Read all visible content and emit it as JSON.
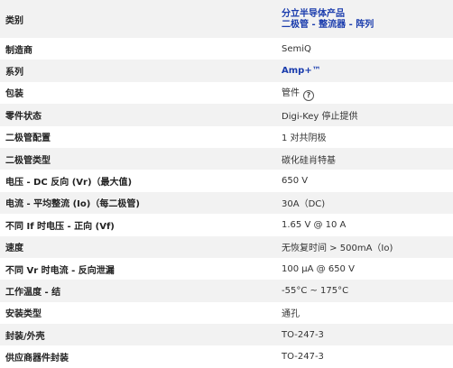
{
  "rows": [
    {
      "label": "类别",
      "value_line1": "分立半导体产品",
      "value_line2": "二极管 - 整流器 - 阵列"
    },
    {
      "label": "制造商",
      "value": "SemiQ"
    },
    {
      "label": "系列",
      "value": "Amp+™"
    },
    {
      "label": "包装",
      "value": "管件",
      "icon": "help-circle-icon",
      "icon_glyph": "?"
    },
    {
      "label": "零件状态",
      "value": "Digi-Key 停止提供"
    },
    {
      "label": "二极管配置",
      "value": "1 对共阴极"
    },
    {
      "label": "二极管类型",
      "value": "碳化硅肖特基"
    },
    {
      "label": "电压 - DC 反向 (Vr)（最大值)",
      "value": "650 V"
    },
    {
      "label": "电流 - 平均整流 (Io)（每二极管)",
      "value": "30A（DC)"
    },
    {
      "label": "不同 If 时电压 - 正向 (Vf)",
      "value": "1.65 V @ 10 A"
    },
    {
      "label": "速度",
      "value": "无恢复时间 > 500mA（Io)"
    },
    {
      "label": "不同 Vr 时电流 - 反向泄漏",
      "value": "100 µA @ 650 V"
    },
    {
      "label": "工作温度 - 结",
      "value": "-55°C ~ 175°C"
    },
    {
      "label": "安装类型",
      "value": "通孔"
    },
    {
      "label": "封装/外壳",
      "value": "TO-247-3"
    },
    {
      "label": "供应商器件封装",
      "value": "TO-247-3"
    }
  ]
}
